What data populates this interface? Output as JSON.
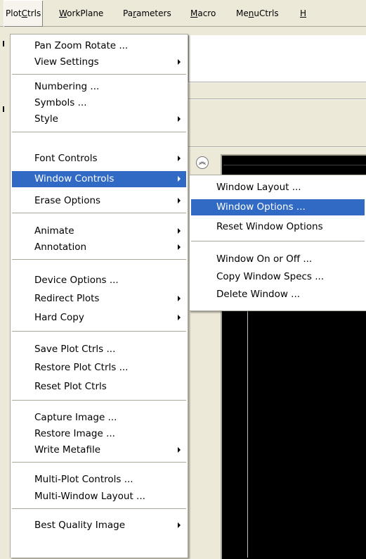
{
  "menubar": {
    "items": [
      {
        "pre": "Plot",
        "key": "C",
        "post": "trls"
      },
      {
        "pre": "",
        "key": "W",
        "post": "orkPlane"
      },
      {
        "pre": "Pa",
        "key": "r",
        "post": "ameters"
      },
      {
        "pre": "",
        "key": "M",
        "post": "acro"
      },
      {
        "pre": "Me",
        "key": "n",
        "post": "uCtrls"
      },
      {
        "pre": "",
        "key": "H",
        "post": ""
      }
    ]
  },
  "main_menu": {
    "items": [
      {
        "label": "Pan Zoom Rotate ...",
        "submenu": false
      },
      {
        "label": "View Settings",
        "submenu": true
      },
      {
        "label": "Numbering ...",
        "submenu": false
      },
      {
        "label": "Symbols ...",
        "submenu": false
      },
      {
        "label": "Style",
        "submenu": true
      },
      {
        "label": "Font Controls",
        "submenu": true
      },
      {
        "label": "Window Controls",
        "submenu": true,
        "highlighted": true
      },
      {
        "label": "Erase Options",
        "submenu": true
      },
      {
        "label": "Animate",
        "submenu": true
      },
      {
        "label": "Annotation",
        "submenu": true
      },
      {
        "label": "Device Options ...",
        "submenu": false
      },
      {
        "label": "Redirect Plots",
        "submenu": true
      },
      {
        "label": "Hard Copy",
        "submenu": true
      },
      {
        "label": "Save Plot Ctrls ...",
        "submenu": false
      },
      {
        "label": "Restore Plot Ctrls ...",
        "submenu": false
      },
      {
        "label": "Reset Plot Ctrls",
        "submenu": false
      },
      {
        "label": "Capture Image ...",
        "submenu": false
      },
      {
        "label": "Restore Image ...",
        "submenu": false
      },
      {
        "label": "Write Metafile",
        "submenu": true
      },
      {
        "label": "Multi-Plot Controls ...",
        "submenu": false
      },
      {
        "label": "Multi-Window Layout ...",
        "submenu": false
      },
      {
        "label": "Best Quality Image",
        "submenu": true
      }
    ]
  },
  "sub_menu": {
    "items": [
      {
        "label": "Window Layout ..."
      },
      {
        "label": "Window Options ...",
        "highlighted": true
      },
      {
        "label": "Reset Window Options"
      },
      {
        "label": "Window On or Off ..."
      },
      {
        "label": "Copy Window Specs ..."
      },
      {
        "label": "Delete Window ..."
      }
    ]
  },
  "colors": {
    "highlight": "#316ac5",
    "menu_bg": "#ffffff",
    "chrome": "#ece9d8",
    "graphics_bg": "#000000"
  }
}
